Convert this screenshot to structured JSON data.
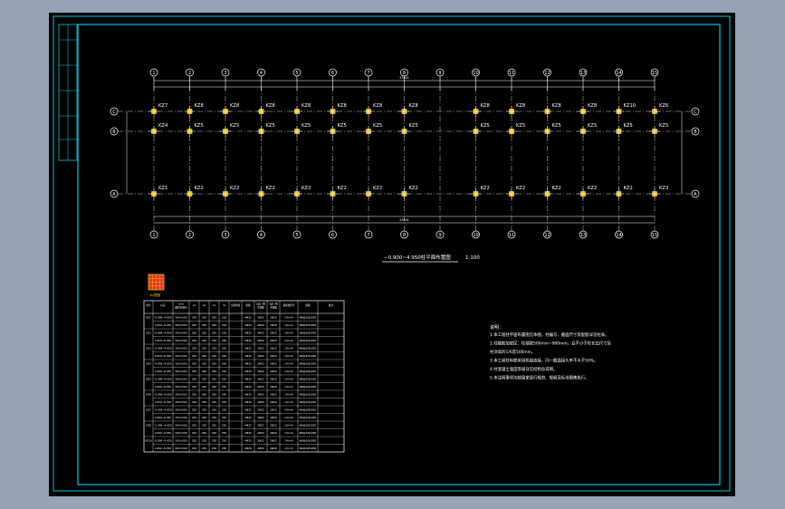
{
  "drawing": {
    "axes_top": [
      "1",
      "2",
      "3",
      "4",
      "5",
      "6",
      "7",
      "8",
      "9",
      "10",
      "11",
      "12",
      "13",
      "14",
      "15"
    ],
    "rows": [
      "C",
      "B",
      "A"
    ],
    "row_C_labels": [
      "KZ7",
      "KZ8",
      "KZ8",
      "KZ8",
      "KZ8",
      "KZ8",
      "KZ8",
      "KZ8",
      "KZ8",
      "KZ8",
      "KZ8",
      "KZ8",
      "KZ10",
      "KZ6"
    ],
    "row_B_labels": [
      "KZ4",
      "KZ5",
      "KZ5",
      "KZ5",
      "KZ5",
      "KZ5",
      "KZ5",
      "KZ5",
      "KZ5",
      "KZ5",
      "KZ5",
      "KZ5",
      "KZ5",
      "KZ5"
    ],
    "row_A_labels": [
      "KZ1",
      "KZ2",
      "KZ2",
      "KZ2",
      "KZ2",
      "KZ2",
      "KZ2",
      "KZ2",
      "KZ2",
      "KZ2",
      "KZ2",
      "KZ2",
      "KZ2",
      "KZ3"
    ],
    "overall_dim": "53400",
    "bottom_overall_dim": "53400",
    "plan_title": "−0.900~4.950柱平面布置图",
    "plan_scale": "1:100",
    "legend_caption": "KZ配筋",
    "colors": {
      "background": "#000000",
      "frame": "#00c8e0",
      "lines": "#ffffff",
      "column": "#f0c000",
      "legend": "#e83030"
    }
  },
  "schedule": {
    "headers": [
      "柱号",
      "标高",
      "b×h\n(圆柱直径D)",
      "b1",
      "b2",
      "h1",
      "h2",
      "全部纵筋",
      "角筋",
      "b边一侧\n中部筋",
      "h边一侧\n中部筋",
      "箍筋类型号",
      "箍筋",
      "备注"
    ],
    "rows": [
      [
        "KZ1",
        "-0.900~4.950",
        "500×500",
        "250",
        "250",
        "250",
        "250",
        "",
        "4Φ22",
        "2Φ22",
        "2Φ22",
        "1(4×4)",
        "Φ8@100/200",
        ""
      ],
      [
        "",
        "4.950~8.550",
        "500×500",
        "250",
        "250",
        "250",
        "250",
        "",
        "4Φ20",
        "2Φ20",
        "2Φ20",
        "1(4×4)",
        "Φ8@100/200",
        ""
      ],
      [
        "KZ2",
        "-0.900~4.950",
        "500×500",
        "250",
        "250",
        "250",
        "250",
        "",
        "4Φ22",
        "2Φ22",
        "2Φ22",
        "1(4×4)",
        "Φ8@100/200",
        ""
      ],
      [
        "",
        "4.950~8.550",
        "500×500",
        "250",
        "250",
        "250",
        "250",
        "",
        "4Φ20",
        "2Φ20",
        "2Φ20",
        "1(4×4)",
        "Φ8@100/200",
        ""
      ],
      [
        "KZ3",
        "-0.900~4.950",
        "500×500",
        "250",
        "250",
        "250",
        "250",
        "",
        "4Φ22",
        "2Φ22",
        "2Φ22",
        "1(4×4)",
        "Φ8@100/200",
        ""
      ],
      [
        "",
        "4.950~8.550",
        "500×500",
        "250",
        "250",
        "250",
        "250",
        "",
        "4Φ20",
        "2Φ20",
        "2Φ20",
        "1(4×4)",
        "Φ8@100/200",
        ""
      ],
      [
        "KZ4",
        "-0.900~4.950",
        "500×500",
        "250",
        "250",
        "250",
        "250",
        "",
        "4Φ22",
        "2Φ22",
        "2Φ22",
        "1(4×4)",
        "Φ8@100/200",
        ""
      ],
      [
        "",
        "4.950~8.550",
        "500×500",
        "250",
        "250",
        "250",
        "250",
        "",
        "4Φ20",
        "2Φ20",
        "2Φ20",
        "1(4×4)",
        "Φ8@100/200",
        ""
      ],
      [
        "KZ5",
        "-0.900~4.950",
        "500×500",
        "250",
        "250",
        "250",
        "250",
        "",
        "4Φ22",
        "2Φ22",
        "2Φ22",
        "1(4×4)",
        "Φ8@100/200",
        ""
      ],
      [
        "",
        "4.950~8.550",
        "500×500",
        "250",
        "250",
        "250",
        "250",
        "",
        "4Φ20",
        "2Φ20",
        "2Φ20",
        "1(4×4)",
        "Φ8@100/200",
        ""
      ],
      [
        "KZ6",
        "-0.900~4.950",
        "500×500",
        "250",
        "250",
        "250",
        "250",
        "",
        "4Φ22",
        "2Φ22",
        "2Φ22",
        "1(4×4)",
        "Φ8@100/200",
        ""
      ],
      [
        "",
        "4.950~8.550",
        "500×500",
        "250",
        "250",
        "250",
        "250",
        "",
        "4Φ20",
        "2Φ20",
        "2Φ20",
        "1(4×4)",
        "Φ8@100/200",
        ""
      ],
      [
        "KZ7",
        "-0.900~4.950",
        "500×500",
        "250",
        "250",
        "250",
        "250",
        "",
        "4Φ22",
        "2Φ22",
        "2Φ22",
        "1(4×4)",
        "Φ8@100/200",
        ""
      ],
      [
        "",
        "4.950~8.550",
        "500×500",
        "250",
        "250",
        "250",
        "250",
        "",
        "4Φ20",
        "2Φ20",
        "2Φ20",
        "1(4×4)",
        "Φ8@100/200",
        ""
      ],
      [
        "KZ8",
        "-0.900~4.950",
        "500×500",
        "250",
        "250",
        "250",
        "250",
        "",
        "4Φ22",
        "2Φ22",
        "2Φ22",
        "1(4×4)",
        "Φ8@100/200",
        ""
      ],
      [
        "",
        "4.950~8.550",
        "500×500",
        "250",
        "250",
        "250",
        "250",
        "",
        "4Φ20",
        "2Φ20",
        "2Φ20",
        "1(4×4)",
        "Φ8@100/200",
        ""
      ],
      [
        "KZ10",
        "-0.900~4.950",
        "500×500",
        "250",
        "250",
        "250",
        "250",
        "",
        "4Φ22",
        "2Φ22",
        "2Φ22",
        "1(4×4)",
        "Φ8@100/200",
        ""
      ],
      [
        "",
        "4.950~8.550",
        "500×500",
        "250",
        "250",
        "250",
        "250",
        "",
        "4Φ20",
        "2Φ20",
        "2Φ20",
        "1(4×4)",
        "Φ8@100/200",
        ""
      ]
    ]
  },
  "notes": {
    "title": "说明：",
    "lines": [
      "1.本工程柱平面布置图见本图，柱编号、截面尺寸及配筋详见柱表。",
      "2.柱箍筋加密区：柱端取500mm~900mm，且不小于柱长边尺寸及",
      "   柱净高的1/6及500mm。",
      "3.本工程柱纵筋采用机械连接，同一截面接头率不大于50%。",
      "4.柱混凝土强度等级详见结构总说明。",
      "5.未注明事项均按国家现行规范、规程及标准图集执行。"
    ]
  }
}
